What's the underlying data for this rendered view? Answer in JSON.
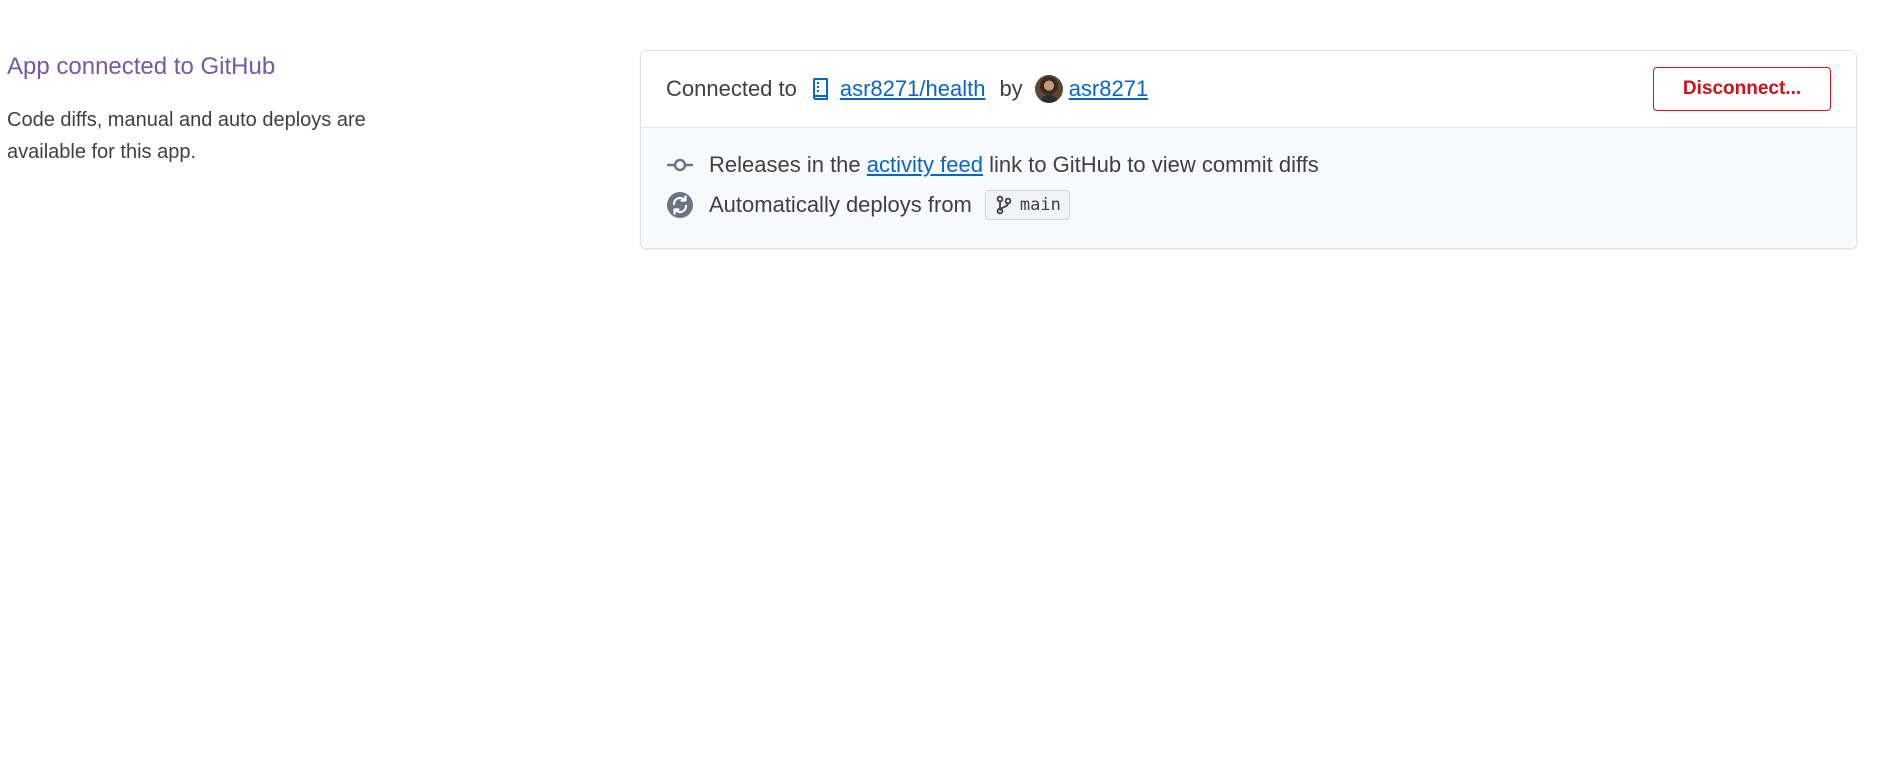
{
  "intro": {
    "title": "App connected to GitHub",
    "description": "Code diffs, manual and auto deploys are available for this app."
  },
  "connection": {
    "connected_label": "Connected to",
    "repo_icon": "repo-icon",
    "repo": "asr8271/health",
    "by_label": "by",
    "user": "asr8271",
    "disconnect_label": "Disconnect..."
  },
  "info": {
    "releases_icon": "commit-icon",
    "releases_prefix": "Releases in the",
    "releases_link": "activity feed",
    "releases_suffix": "link to GitHub to view commit diffs",
    "autodeploy_icon": "sync-icon",
    "autodeploy_label": "Automatically deploys from",
    "branch_icon": "git-branch-icon",
    "branch": "main"
  },
  "colors": {
    "title": "#79589f",
    "link": "#0b66c2",
    "danger": "#cf0f1a",
    "card_body_bg": "#f8f9fb"
  }
}
